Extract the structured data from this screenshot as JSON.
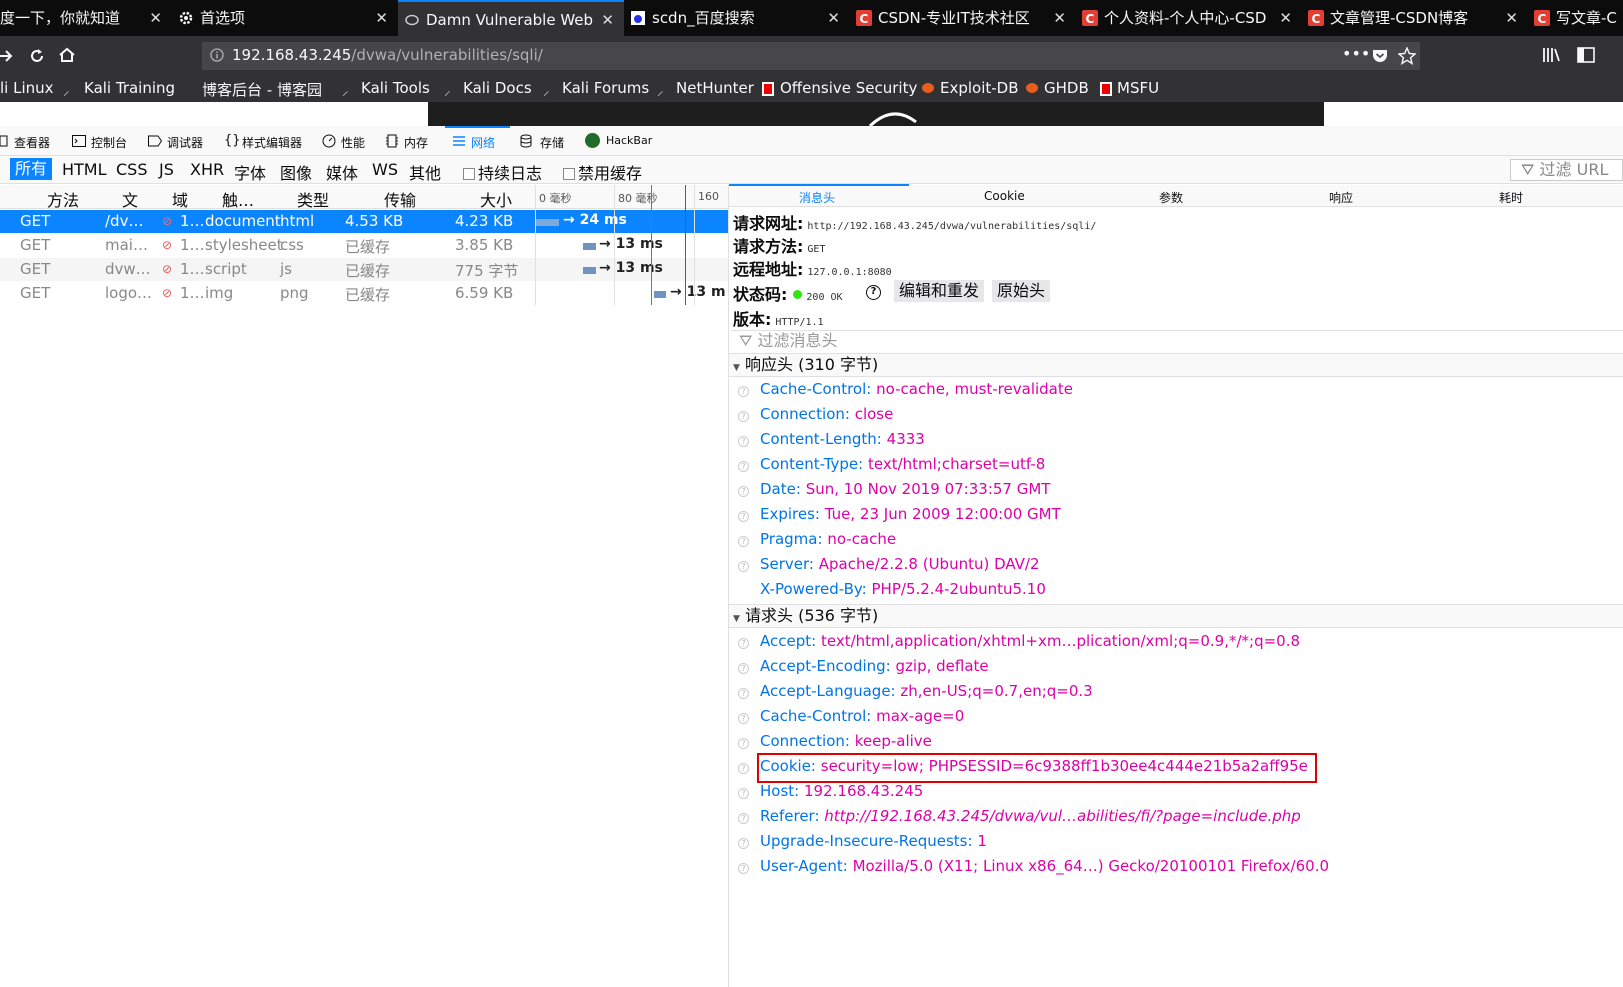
{
  "tabs": [
    {
      "title": "度一下，你就知道",
      "icon": "none"
    },
    {
      "title": "首选项",
      "icon": "gear-icon"
    },
    {
      "title": "Damn Vulnerable Web",
      "icon": "dvwa-icon",
      "active": true
    },
    {
      "title": "scdn_百度搜索",
      "icon": "baidu-icon"
    },
    {
      "title": "CSDN-专业IT技术社区",
      "icon": "csdn-icon"
    },
    {
      "title": "个人资料-个人中心-CSD",
      "icon": "csdn-icon"
    },
    {
      "title": "文章管理-CSDN博客",
      "icon": "csdn-icon"
    },
    {
      "title": "写文章-C",
      "icon": "csdn-icon"
    }
  ],
  "tab_close": "✕",
  "url": {
    "host": "192.168.43.245",
    "path": "/dvwa/vulnerabilities/sqli/"
  },
  "bookmarks": [
    "li Linux",
    "Kali Training",
    "博客后台 - 博客园",
    "Kali Tools",
    "Kali Docs",
    "Kali Forums",
    "NetHunter",
    "Offensive Security",
    "Exploit-DB",
    "GHDB",
    "MSFU"
  ],
  "devtools": {
    "tools": [
      "查看器",
      "控制台",
      "调试器",
      "样式编辑器",
      "性能",
      "内存",
      "网络",
      "存储",
      "HackBar"
    ],
    "active_tool": "网络"
  },
  "filters": [
    "所有",
    "HTML",
    "CSS",
    "JS",
    "XHR",
    "字体",
    "图像",
    "媒体",
    "WS",
    "其他"
  ],
  "options": [
    "持续日志",
    "禁用缓存"
  ],
  "filter_url_placeholder": "过滤 URL",
  "list_columns": [
    "方法",
    "文",
    "域",
    "触…",
    "类型",
    "传输",
    "大小"
  ],
  "timeline_ticks": [
    "0 毫秒",
    "80 毫秒",
    "160"
  ],
  "requests": [
    {
      "method": "GET",
      "file": "/dv…",
      "domain": "1…",
      "cause": "document",
      "type": "html",
      "transferred": "4.53 KB",
      "size": "4.23 KB",
      "time": "→ 24 ms"
    },
    {
      "method": "GET",
      "file": "mai…",
      "domain": "1…",
      "cause": "stylesheet",
      "type": "css",
      "transferred": "已缓存",
      "size": "3.85 KB",
      "time": "→ 13 ms"
    },
    {
      "method": "GET",
      "file": "dvw…",
      "domain": "1…",
      "cause": "script",
      "type": "js",
      "transferred": "已缓存",
      "size": "775 字节",
      "time": "→ 13 ms"
    },
    {
      "method": "GET",
      "file": "logo…",
      "domain": "1…",
      "cause": "img",
      "type": "png",
      "transferred": "已缓存",
      "size": "6.59 KB",
      "time": "→ 13 m"
    }
  ],
  "detail_tabs": [
    "消息头",
    "Cookie",
    "参数",
    "响应",
    "耗时"
  ],
  "summary": {
    "url_label": "请求网址:",
    "url_value": "http://192.168.43.245/dvwa/vulnerabilities/sqli/",
    "method_label": "请求方法:",
    "method_value": "GET",
    "remote_label": "远程地址:",
    "remote_value": "127.0.0.1:8080",
    "status_label": "状态码:",
    "status_value": "200 OK",
    "status_color": "#30e60b",
    "version_label": "版本:",
    "version_value": "HTTP/1.1",
    "edit_resend": "编辑和重发",
    "raw_headers": "原始头",
    "filter_headers": "过滤消息头"
  },
  "response_headers_title": "响应头 (310 字节)",
  "response_headers": [
    {
      "k": "Cache-Control:",
      "v": "no-cache, must-revalidate"
    },
    {
      "k": "Connection:",
      "v": "close"
    },
    {
      "k": "Content-Length:",
      "v": "4333"
    },
    {
      "k": "Content-Type:",
      "v": "text/html;charset=utf-8"
    },
    {
      "k": "Date:",
      "v": "Sun, 10 Nov 2019 07:33:57 GMT"
    },
    {
      "k": "Expires:",
      "v": "Tue, 23 Jun 2009 12:00:00 GMT"
    },
    {
      "k": "Pragma:",
      "v": "no-cache"
    },
    {
      "k": "Server:",
      "v": "Apache/2.2.8 (Ubuntu) DAV/2"
    },
    {
      "k": "X-Powered-By:",
      "v": "PHP/5.2.4-2ubuntu5.10"
    }
  ],
  "request_headers_title": "请求头 (536 字节)",
  "request_headers": [
    {
      "k": "Accept:",
      "v": "text/html,application/xhtml+xm…plication/xml;q=0.9,*/*;q=0.8"
    },
    {
      "k": "Accept-Encoding:",
      "v": "gzip, deflate"
    },
    {
      "k": "Accept-Language:",
      "v": "zh,en-US;q=0.7,en;q=0.3"
    },
    {
      "k": "Cache-Control:",
      "v": "max-age=0"
    },
    {
      "k": "Connection:",
      "v": "keep-alive"
    },
    {
      "k": "Cookie:",
      "v": "security=low; PHPSESSID=6c9388ff1b30ee4c444e21b5a2aff95e"
    },
    {
      "k": "Host:",
      "v": "192.168.43.245"
    },
    {
      "k": "Referer:",
      "v": "http://192.168.43.245/dvwa/vul…abilities/fi/?page=include.php"
    },
    {
      "k": "Upgrade-Insecure-Requests:",
      "v": "1"
    },
    {
      "k": "User-Agent:",
      "v": "Mozilla/5.0 (X11; Linux x86_64…) Gecko/20100101 Firefox/60.0"
    }
  ]
}
